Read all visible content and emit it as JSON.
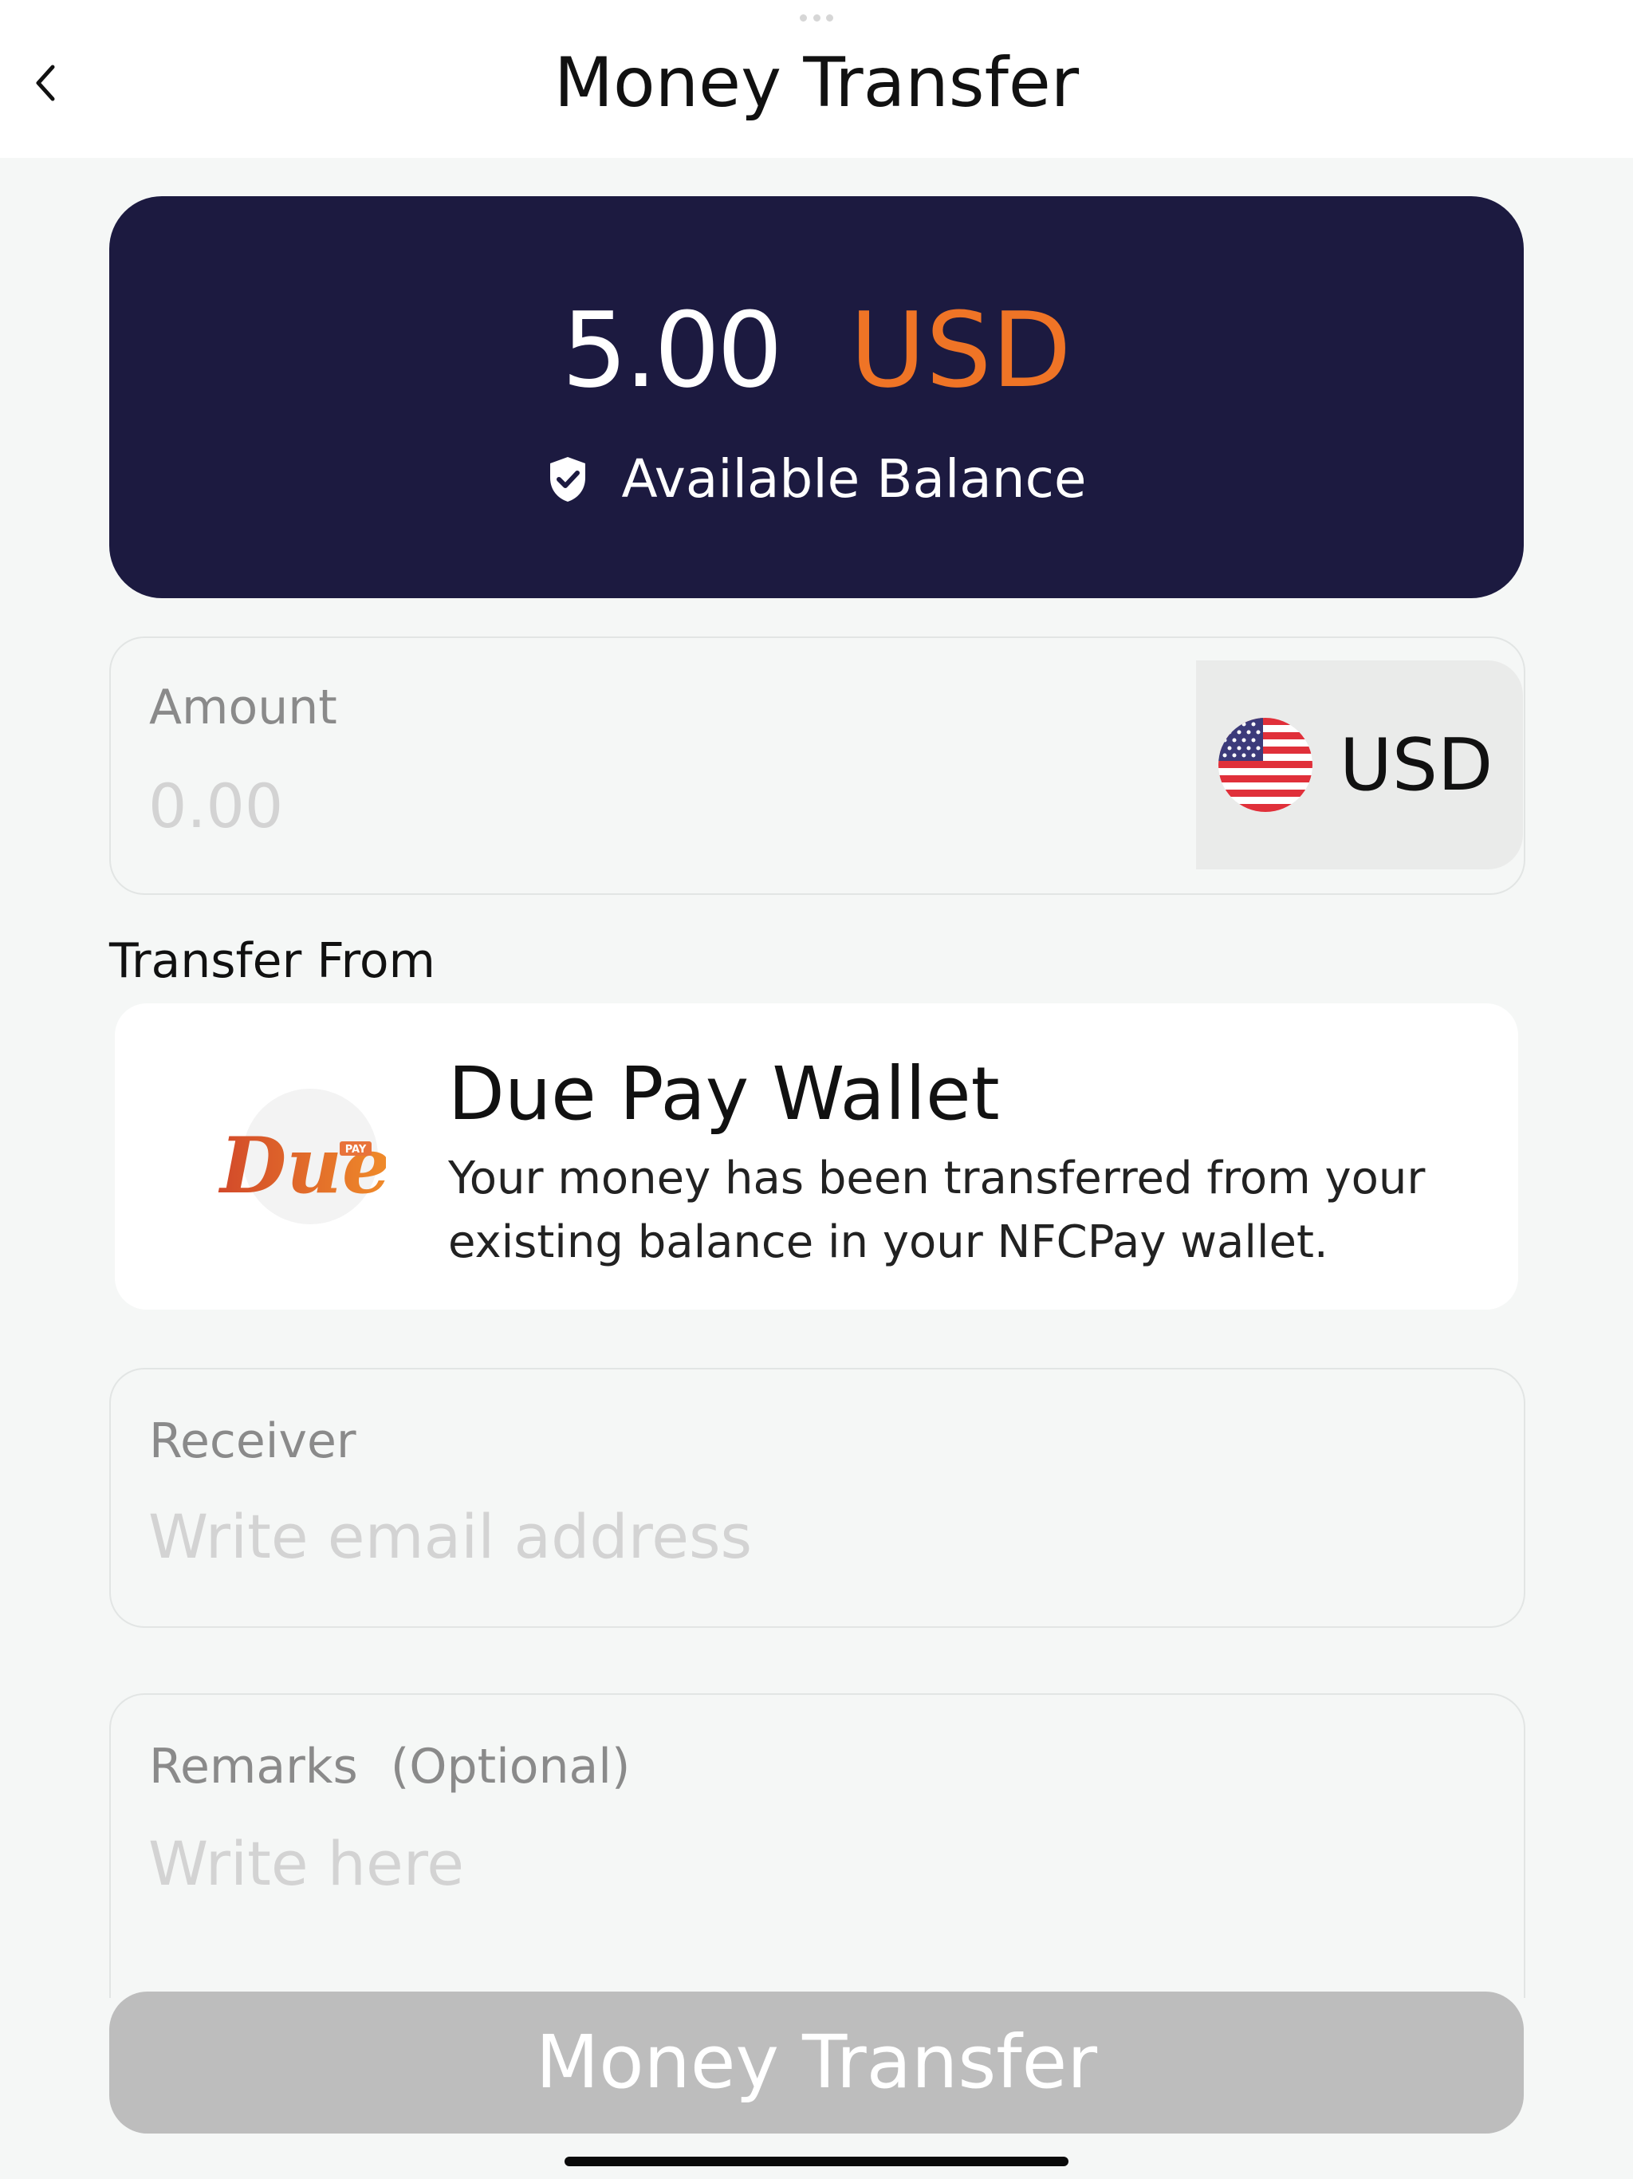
{
  "header": {
    "title": "Money Transfer"
  },
  "balance": {
    "amount": "5.00",
    "currency": "USD",
    "label": "Available Balance"
  },
  "amount_field": {
    "label": "Amount",
    "placeholder": "0.00",
    "currency": "USD",
    "currency_flag": "us-flag-icon"
  },
  "transfer_from": {
    "label": "Transfer From",
    "wallet_name": "Due Pay Wallet",
    "wallet_description": "Your money has been transferred from your existing balance in your NFCPay wallet.",
    "logo": {
      "wordmark": "Due",
      "tag": "PAY"
    }
  },
  "receiver_field": {
    "label": "Receiver",
    "placeholder": "Write email address"
  },
  "remarks_field": {
    "label": "Remarks",
    "optional": "(Optional)",
    "placeholder": "Write here"
  },
  "submit_label": "Money Transfer",
  "colors": {
    "card_bg": "#1c1a40",
    "accent": "#ef7426",
    "button_disabled": "#bdbdbd"
  }
}
